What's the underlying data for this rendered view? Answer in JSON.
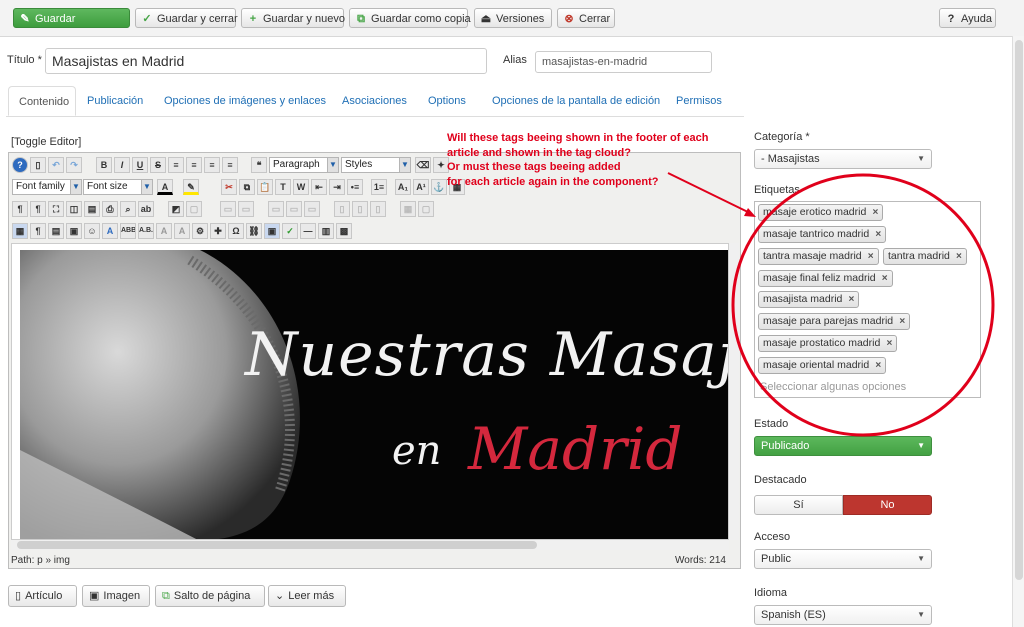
{
  "toolbar": {
    "save": "Guardar",
    "save_close": "Guardar y cerrar",
    "save_new": "Guardar y nuevo",
    "save_copy": "Guardar como copia",
    "versions": "Versiones",
    "close": "Cerrar",
    "help": "Ayuda"
  },
  "form": {
    "title_label": "Título *",
    "title_value": "Masajistas en Madrid",
    "alias_label": "Alias",
    "alias_value": "masajistas-en-madrid"
  },
  "tabs": [
    "Contenido",
    "Publicación",
    "Opciones de imágenes y enlaces",
    "Asociaciones",
    "Options",
    "Opciones de la pantalla de edición",
    "Permisos"
  ],
  "editor": {
    "toggle": "[Toggle Editor]",
    "format_select": "Paragraph",
    "styles_select": "Styles",
    "font_family": "Font family",
    "font_size": "Font size",
    "path": "Path:  p » img",
    "words": "Words: 214",
    "image_line1": "Nuestras Masajis",
    "image_line2_a": "en",
    "image_line2_b": "Madrid"
  },
  "bottom_buttons": {
    "article": "Artículo",
    "image": "Imagen",
    "pagebreak": "Salto de página",
    "readmore": "Leer más"
  },
  "annotation": [
    "Will these tags beeing shown in the footer of each",
    "article and shown in the tag cloud?",
    "Or must these tags beeing added",
    "for each article again in the component?"
  ],
  "sidebar": {
    "category_label": "Categoría *",
    "category_value": "- Masajistas",
    "tags_label": "Etiquetas",
    "tags": [
      "masaje erotico madrid",
      "masaje tantrico madrid",
      "tantra masaje madrid",
      "tantra madrid",
      "masaje final feliz madrid",
      "masajista madrid",
      "masaje para parejas madrid",
      "masaje prostatico madrid",
      "masaje oriental madrid"
    ],
    "tags_placeholder": "Seleccionar algunas opciones",
    "state_label": "Estado",
    "state_value": "Publicado",
    "featured_label": "Destacado",
    "featured_yes": "Sí",
    "featured_no": "No",
    "access_label": "Acceso",
    "access_value": "Public",
    "language_label": "Idioma",
    "language_value": "Spanish (ES)"
  },
  "colors": {
    "save_green": "#46a546",
    "published_green": "#4cae4c",
    "no_red": "#bd362f",
    "annotation_red": "#e0001b",
    "link_blue": "#1f6fb5"
  }
}
